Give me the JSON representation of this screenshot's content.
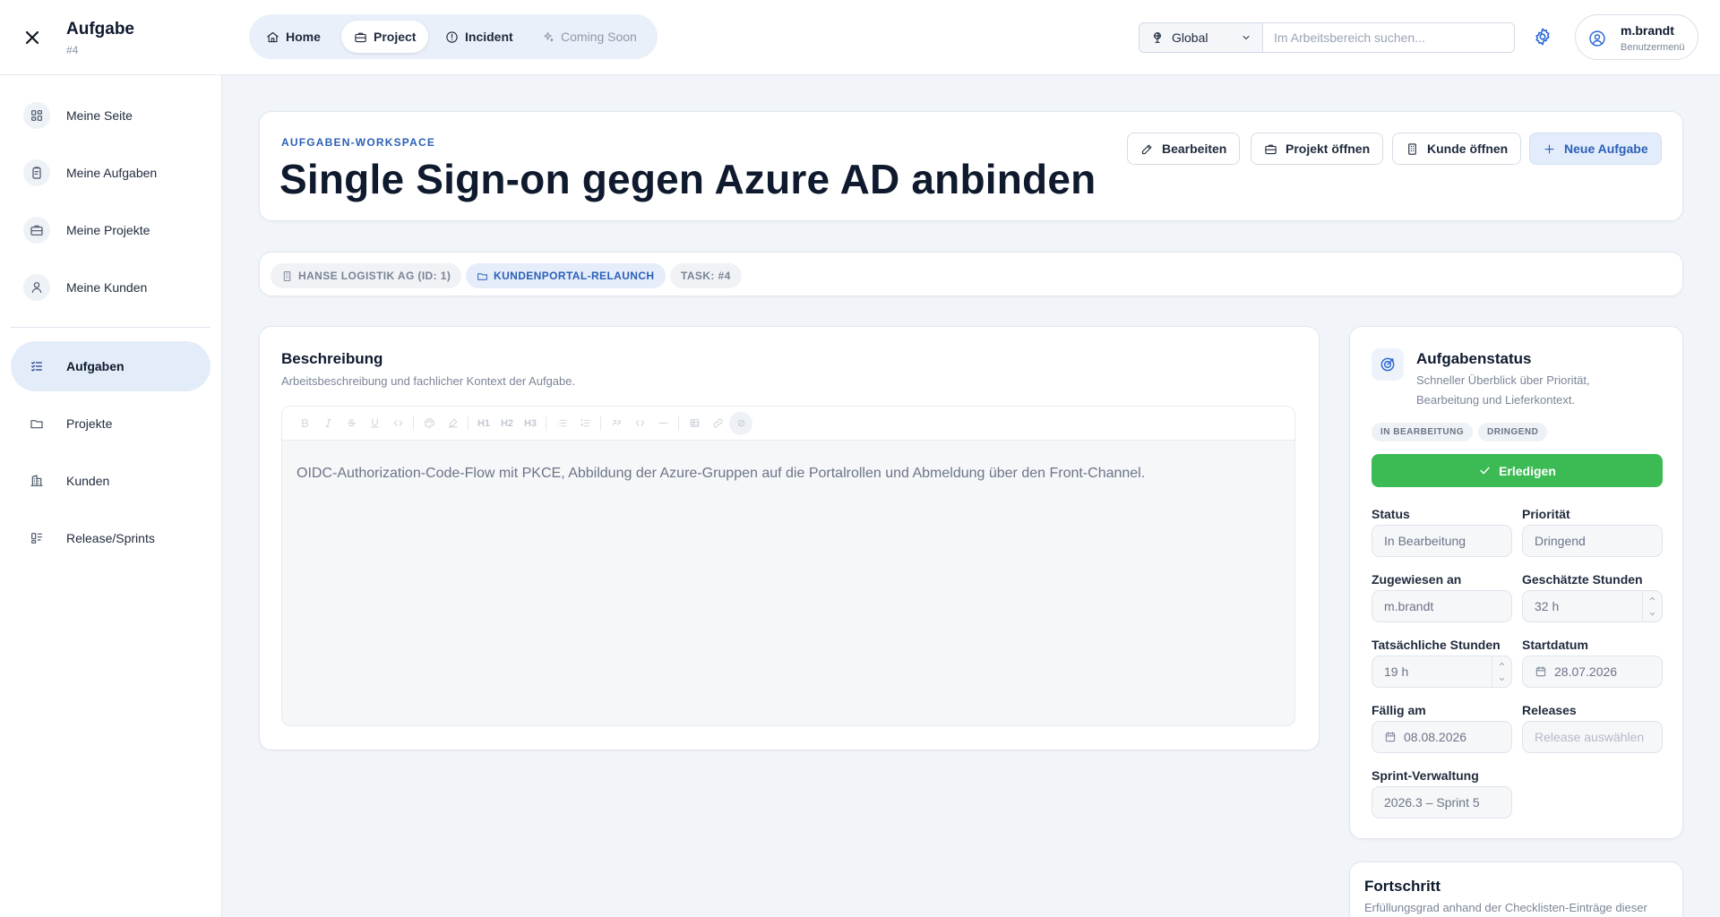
{
  "window": {
    "title": "Aufgabe",
    "subtitle": "#4"
  },
  "module_nav": [
    {
      "label": "Home",
      "icon": "home-icon"
    },
    {
      "label": "Project",
      "icon": "briefcase-icon",
      "active": true
    },
    {
      "label": "Incident",
      "icon": "alert-circle-icon"
    },
    {
      "label": "Coming Soon",
      "icon": "sparkles-icon",
      "disabled": true
    }
  ],
  "scope_select": {
    "value": "Global",
    "icon": "globe-pin-icon"
  },
  "search": {
    "placeholder": "Im Arbeitsbereich suchen..."
  },
  "user": {
    "name": "m.brandt",
    "role": "Benutzermenü"
  },
  "sidebar": {
    "items": [
      {
        "label": "Meine Seite",
        "icon": "dashboard-icon"
      },
      {
        "label": "Meine Aufgaben",
        "icon": "clipboard-icon"
      },
      {
        "label": "Meine Projekte",
        "icon": "briefcase-icon"
      },
      {
        "label": "Meine Kunden",
        "icon": "user-icon"
      },
      {
        "label": "Aufgaben",
        "icon": "list-check-icon",
        "active": true
      },
      {
        "label": "Projekte",
        "icon": "folder-icon"
      },
      {
        "label": "Kunden",
        "icon": "building-icon"
      },
      {
        "label": "Release/Sprints",
        "icon": "kanban-icon"
      }
    ]
  },
  "header": {
    "eyebrow": "AUFGABEN-WORKSPACE",
    "title": "Single Sign-on gegen Azure AD anbinden",
    "actions": {
      "edit": "Bearbeiten",
      "open_project": "Projekt öffnen",
      "open_customer": "Kunde öffnen",
      "new_task": "Neue Aufgabe"
    }
  },
  "breadcrumbs": {
    "customer": "HANSE LOGISTIK AG (ID: 1)",
    "project": "KUNDENPORTAL-RELAUNCH",
    "task": "TASK: #4"
  },
  "description": {
    "title": "Beschreibung",
    "subtitle": "Arbeitsbeschreibung und fachlicher Kontext der Aufgabe.",
    "text": "OIDC-Authorization-Code-Flow mit PKCE, Abbildung der Azure-Gruppen auf die Portalrollen und Abmeldung über den Front-Channel.",
    "toolbar": {
      "h1": "H1",
      "h2": "H2",
      "h3": "H3"
    }
  },
  "status_panel": {
    "title": "Aufgabenstatus",
    "subtitle_line1": "Schneller Überblick über Priorität,",
    "subtitle_line2": "Bearbeitung und Lieferkontext.",
    "badges": [
      "IN BEARBEITUNG",
      "DRINGEND"
    ],
    "done_button": "Erledigen",
    "fields": {
      "status": {
        "label": "Status",
        "value": "In Bearbeitung"
      },
      "priority": {
        "label": "Priorität",
        "value": "Dringend"
      },
      "assignee": {
        "label": "Zugewiesen an",
        "value": "m.brandt"
      },
      "estimated_hours": {
        "label": "Geschätzte Stunden",
        "value": "32 h"
      },
      "actual_hours": {
        "label": "Tatsächliche Stunden",
        "value": "19 h"
      },
      "start_date": {
        "label": "Startdatum",
        "value": "28.07.2026"
      },
      "due_date": {
        "label": "Fällig am",
        "value": "08.08.2026"
      },
      "releases": {
        "label": "Releases",
        "placeholder": "Release auswählen"
      },
      "sprint": {
        "label": "Sprint-Verwaltung",
        "value": "2026.3 – Sprint 5"
      }
    }
  },
  "progress": {
    "title": "Fortschritt",
    "subtitle": "Erfüllungsgrad anhand der Checklisten-Einträge dieser"
  },
  "colors": {
    "accent": "#2b5fb8",
    "success": "#3cba54",
    "page_bg": "#f1f4f9"
  }
}
